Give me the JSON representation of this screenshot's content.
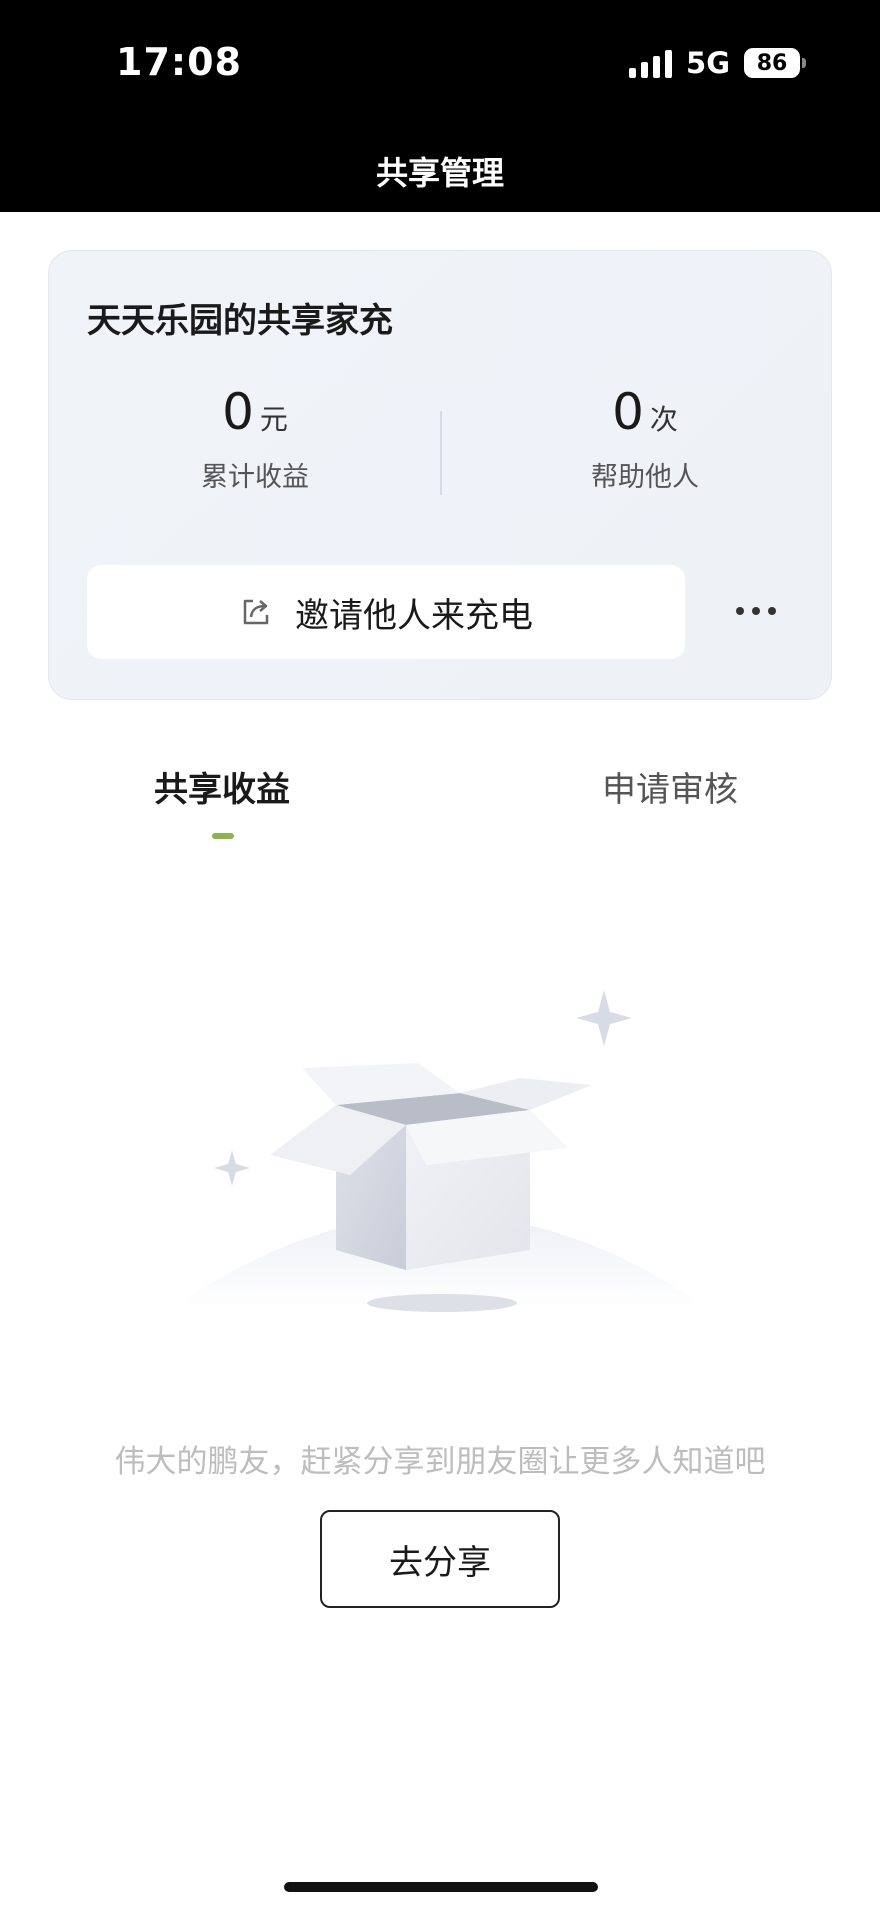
{
  "status_bar": {
    "time": "17:08",
    "network": "5G",
    "battery": "86"
  },
  "nav": {
    "title": "共享管理"
  },
  "card": {
    "title": "天天乐园的共享家充",
    "earnings": {
      "value": "0",
      "unit": "元",
      "label": "累计收益"
    },
    "helped": {
      "value": "0",
      "unit": "次",
      "label": "帮助他人"
    },
    "invite_label": "邀请他人来充电"
  },
  "tabs": [
    {
      "label": "共享收益",
      "active": true
    },
    {
      "label": "申请审核",
      "active": false
    }
  ],
  "empty_state": {
    "message": "伟大的鹏友，赶紧分享到朋友圈让更多人知道吧",
    "button_label": "去分享"
  },
  "colors": {
    "accent": "#8bb34e",
    "header_bg": "#000000"
  }
}
